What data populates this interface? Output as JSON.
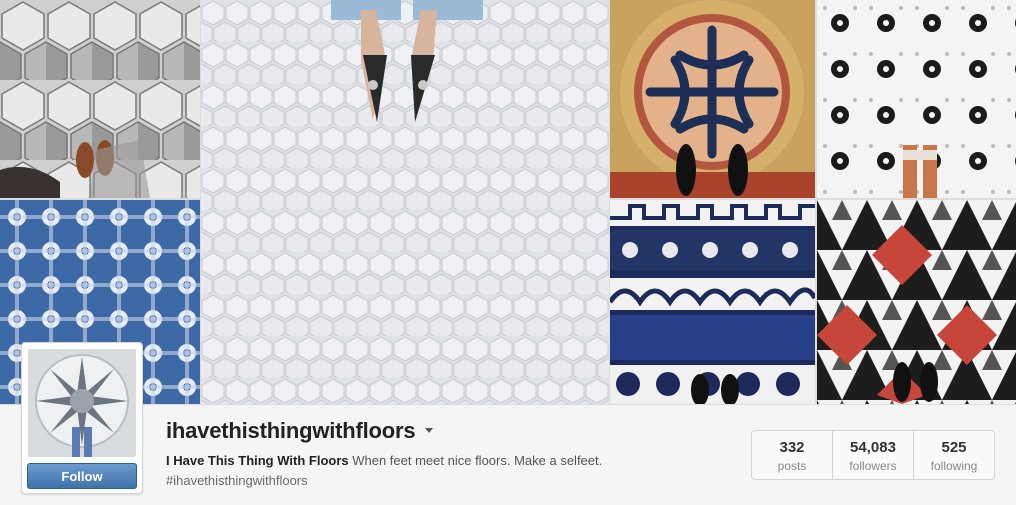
{
  "profile": {
    "username": "ihavethisthingwithfloors",
    "display_name": "I Have This Thing With Floors",
    "bio": "When feet meet nice floors. Make a selfeet.",
    "hashtag": "#ihavethisthingwithfloors",
    "follow_label": "Follow"
  },
  "stats": [
    {
      "value": "332",
      "label": "posts"
    },
    {
      "value": "54,083",
      "label": "followers"
    },
    {
      "value": "525",
      "label": "following"
    }
  ],
  "icons": {
    "dropdown": "chevron-down-icon"
  },
  "colors": {
    "follow_button": "#4a7db5",
    "background": "#f5f5f5"
  }
}
